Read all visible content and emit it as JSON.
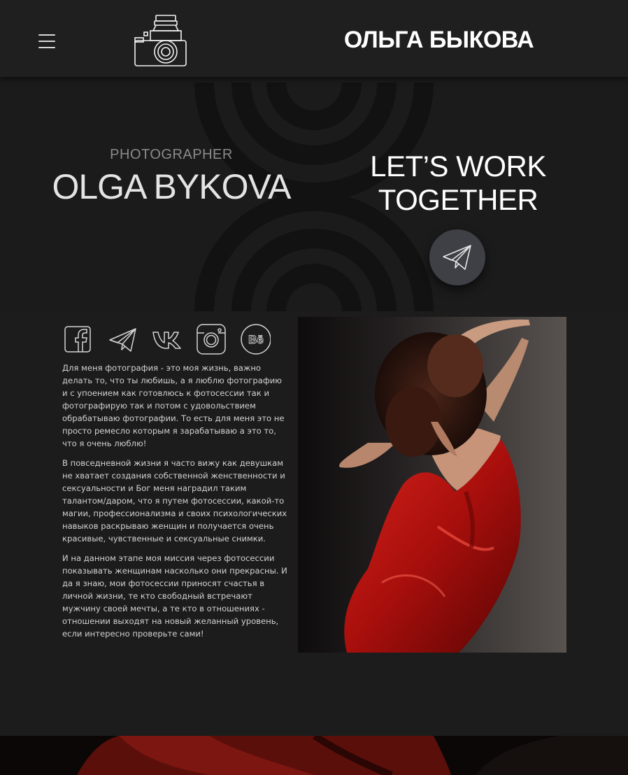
{
  "header": {
    "brand": "ОЛЬГА БЫКОВА",
    "menu_icon": "hamburger-menu-icon",
    "logo_icon": "camera-icon"
  },
  "hero": {
    "role": "PHOTOGRAPHER",
    "name": "OLGA BYKOVA",
    "cta_line1": "LET’S WORK",
    "cta_line2": "TOGETHER",
    "cta_icon": "telegram-send-icon"
  },
  "social": [
    {
      "name": "facebook",
      "icon": "facebook-icon"
    },
    {
      "name": "telegram",
      "icon": "telegram-icon"
    },
    {
      "name": "vk",
      "icon": "vk-icon"
    },
    {
      "name": "instagram",
      "icon": "instagram-icon"
    },
    {
      "name": "behance",
      "icon": "behance-icon",
      "glyph": "Bē"
    }
  ],
  "about": {
    "p1": "Для меня фотография - это моя жизнь, важно делать то, что ты любишь, а я люблю фотографию и с упоением как готовлюсь к фотосессии так и фотографирую так и потом с удовольствием обрабатываю фотографии. То есть для меня это не просто ремесло которым я зарабатываю а это то, что я очень люблю!",
    "p2": "В повседневной жизни я часто вижу как девушкам не хватает создания собственной женственности и сексуальности и Бог меня наградил таким талантом/даром, что я путем фотосессии, какой-то магии, профессионализма и своих психологических навыков раскрываю женщин и получается очень красивые, чувственные и сексуальные снимки.",
    "p3": "И на данном этапе моя миссия через фотосессии показывать женщинам насколько они прекрасны. И да я знаю, мои фотосессии приносят счастья в личной жизни, те кто свободный встречают мужчину своей мечты, а те кто в отношениях - отношении выходят на новый желанный уровень, если интересно проверьте сами!"
  },
  "colors": {
    "background": "#1c1c1d",
    "header": "#1f1f20",
    "dress_red": "#b5120f",
    "button": "#3e4046"
  }
}
